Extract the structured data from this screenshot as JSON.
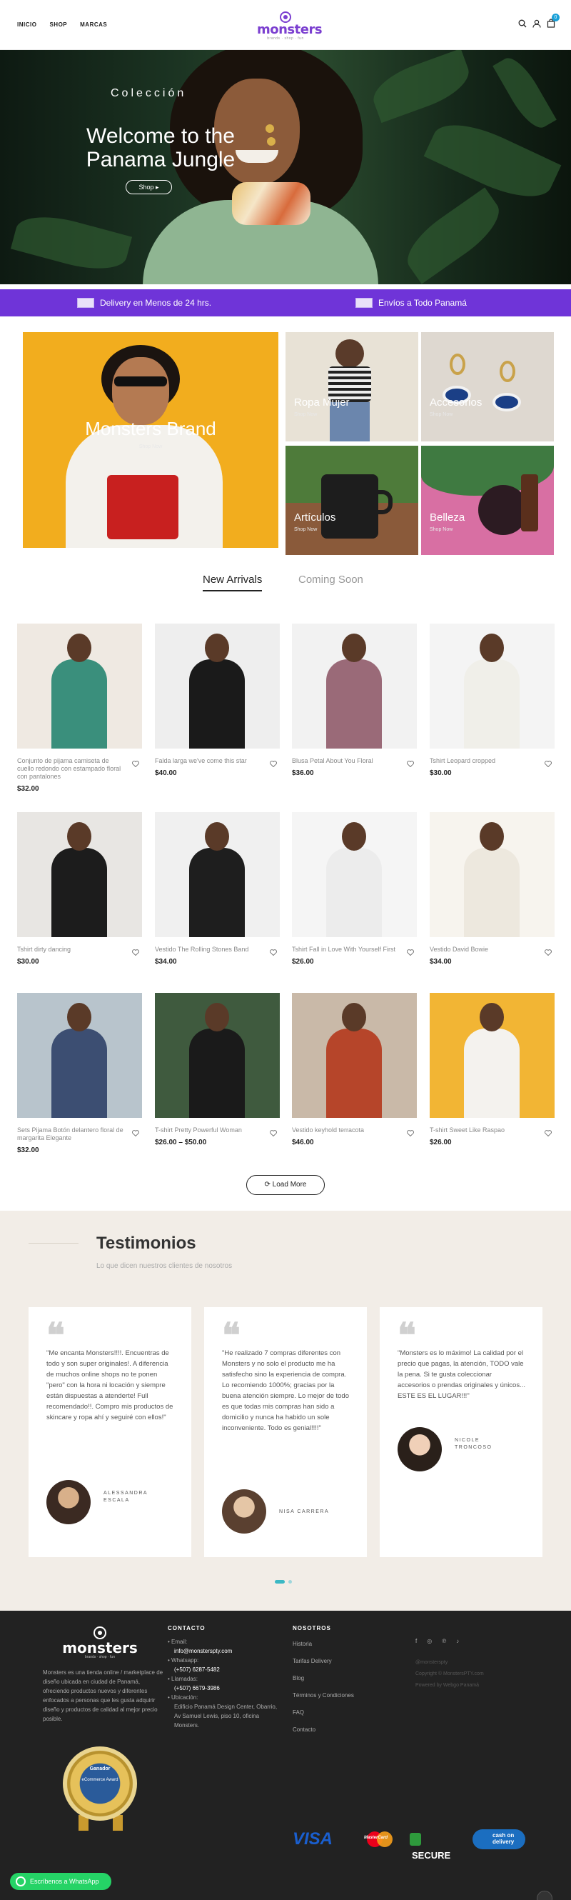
{
  "header": {
    "nav": [
      "INICIO",
      "SHOP",
      "MARCAS"
    ],
    "logo": "monsters",
    "tagline": "brands · shop · fun",
    "cart_count": "0"
  },
  "hero": {
    "subtitle": "Colección",
    "title": "Welcome to the Panama Jungle",
    "button": "Shop ▸"
  },
  "banner": {
    "left": "Delivery en Menos de 24 hrs.",
    "right": "Envíos a Todo Panamá"
  },
  "categories": {
    "main": "Monsters Brand",
    "main_sub": "Shop Now",
    "items": [
      {
        "label": "Ropa Mujer",
        "sub": "Shop Now"
      },
      {
        "label": "Accesorios",
        "sub": "Shop Now"
      },
      {
        "label": "Artículos",
        "sub": "Shop Now"
      },
      {
        "label": "Belleza",
        "sub": "Shop Now"
      }
    ]
  },
  "tabs": [
    "New Arrivals",
    "Coming Soon"
  ],
  "products": [
    {
      "name": "Conjunto de pijama camiseta de cuello redondo con estampado floral con pantalones",
      "price": "$32.00",
      "bg": "#efe9e2",
      "fig": "#3a8f7c"
    },
    {
      "name": "Falda larga we've come this star",
      "price": "$40.00",
      "bg": "#eeeeee",
      "fig": "#1a1a1a"
    },
    {
      "name": "Blusa Petal About You Floral",
      "price": "$36.00",
      "bg": "#f2f2f2",
      "fig": "#9a6a78"
    },
    {
      "name": "Tshirt Leopard cropped",
      "price": "$30.00",
      "bg": "#f4f4f4",
      "fig": "#f0efe9"
    },
    {
      "name": "Tshirt dirty dancing",
      "price": "$30.00",
      "bg": "#e8e6e3",
      "fig": "#1c1c1c"
    },
    {
      "name": "Vestido The Rolling Stones Band",
      "price": "$34.00",
      "bg": "#f0f0f0",
      "fig": "#1e1e1e"
    },
    {
      "name": "Tshirt Fall in Love With Yourself First",
      "price": "$26.00",
      "bg": "#f5f5f5",
      "fig": "#ececec"
    },
    {
      "name": "Vestido David Bowie",
      "price": "$34.00",
      "bg": "#f7f4ee",
      "fig": "#ede8de"
    },
    {
      "name": "Sets Pijama Botón delantero floral de margarita Elegante",
      "price": "$32.00",
      "bg": "#b8c4cc",
      "fig": "#3c4e72"
    },
    {
      "name": "T-shirt Pretty Powerful Woman",
      "price": "$26.00 – $50.00",
      "bg": "#3f5a3e",
      "fig": "#1a1a1a"
    },
    {
      "name": "Vestido keyhold terracota",
      "price": "$46.00",
      "bg": "#c9b9a8",
      "fig": "#b6452a"
    },
    {
      "name": "T-shirt Sweet Like Raspao",
      "price": "$26.00",
      "bg": "#f2b534",
      "fig": "#f4f2ee"
    }
  ],
  "load_more": "Load More",
  "testimonials": {
    "title": "Testimonios",
    "subtitle": "Lo que dicen nuestros clientes de nosotros",
    "items": [
      {
        "text": "\"Me encanta Monsters!!!!. Encuentras de todo y son super originales!. A diferencia de muchos online shops no te ponen \"pero\" con la hora ni locación y siempre están dispuestas a atenderte! Full recomendado!!. Compro mis productos de skincare y ropa ahí y seguiré con ellos!\"",
        "name": "ALESSANDRA ESCALA"
      },
      {
        "text": "\"He realizado 7 compras diferentes con Monsters y no solo el producto me ha satisfecho sino la experiencia de compra. Lo recomiendo 1000%; gracias por la buena atención siempre. Lo mejor de todo es que todas mis compras han sido a domicilio y nunca ha habido un sole inconveniente. Todo es genial!!!!\"",
        "name": "NISA CARRERA"
      },
      {
        "text": "\"Monsters es lo máximo! La calidad por el precio que pagas, la atención, TODO vale la pena. Si te gusta coleccionar accesorios o prendas originales y únicos... ESTE ES EL LUGAR!!!\"",
        "name": "NICOLE TRONCOSO"
      }
    ]
  },
  "footer": {
    "logo": "monsters",
    "tagline": "brands · shop · fun",
    "about": "Monsters es una tienda online / marketplace de diseño ubicada en ciudad de Panamá, ofreciendo productos nuevos y diferentes enfocados a personas que les gusta adquirir diseño y productos de calidad al mejor precio posible.",
    "seal_title": "Ganador",
    "seal_sub": "eCommerce Award",
    "contact_heading": "CONTACTO",
    "contact": [
      {
        "k": "Email:",
        "v": "info@monsterspty.com"
      },
      {
        "k": "Whatsapp:",
        "v": "(+507) 6287-5482"
      },
      {
        "k": "Llamadas:",
        "v": "(+507) 6679-3986"
      },
      {
        "k": "Ubicación:",
        "v": "Edificio Panamá Design Center, Obarrio, Av Samuel Lewis, piso 10, oficina Monsters."
      }
    ],
    "nosotros_heading": "NOSOTROS",
    "nosotros": [
      "Historia",
      "Tarifas Delivery",
      "Blog",
      "Términos y Condiciones",
      "FAQ",
      "Contacto"
    ],
    "social": [
      "f",
      "◎",
      "℗",
      "♪"
    ],
    "handle": "@monsterspty",
    "copyright": "Copyright © MonstersPTY.com",
    "powered": "Powered by Webgo Panamá",
    "payments": [
      "VISA",
      "MasterCard",
      "SECURE",
      "cash on delivery"
    ]
  },
  "whatsapp": "Escríbenos a WhatsApp"
}
